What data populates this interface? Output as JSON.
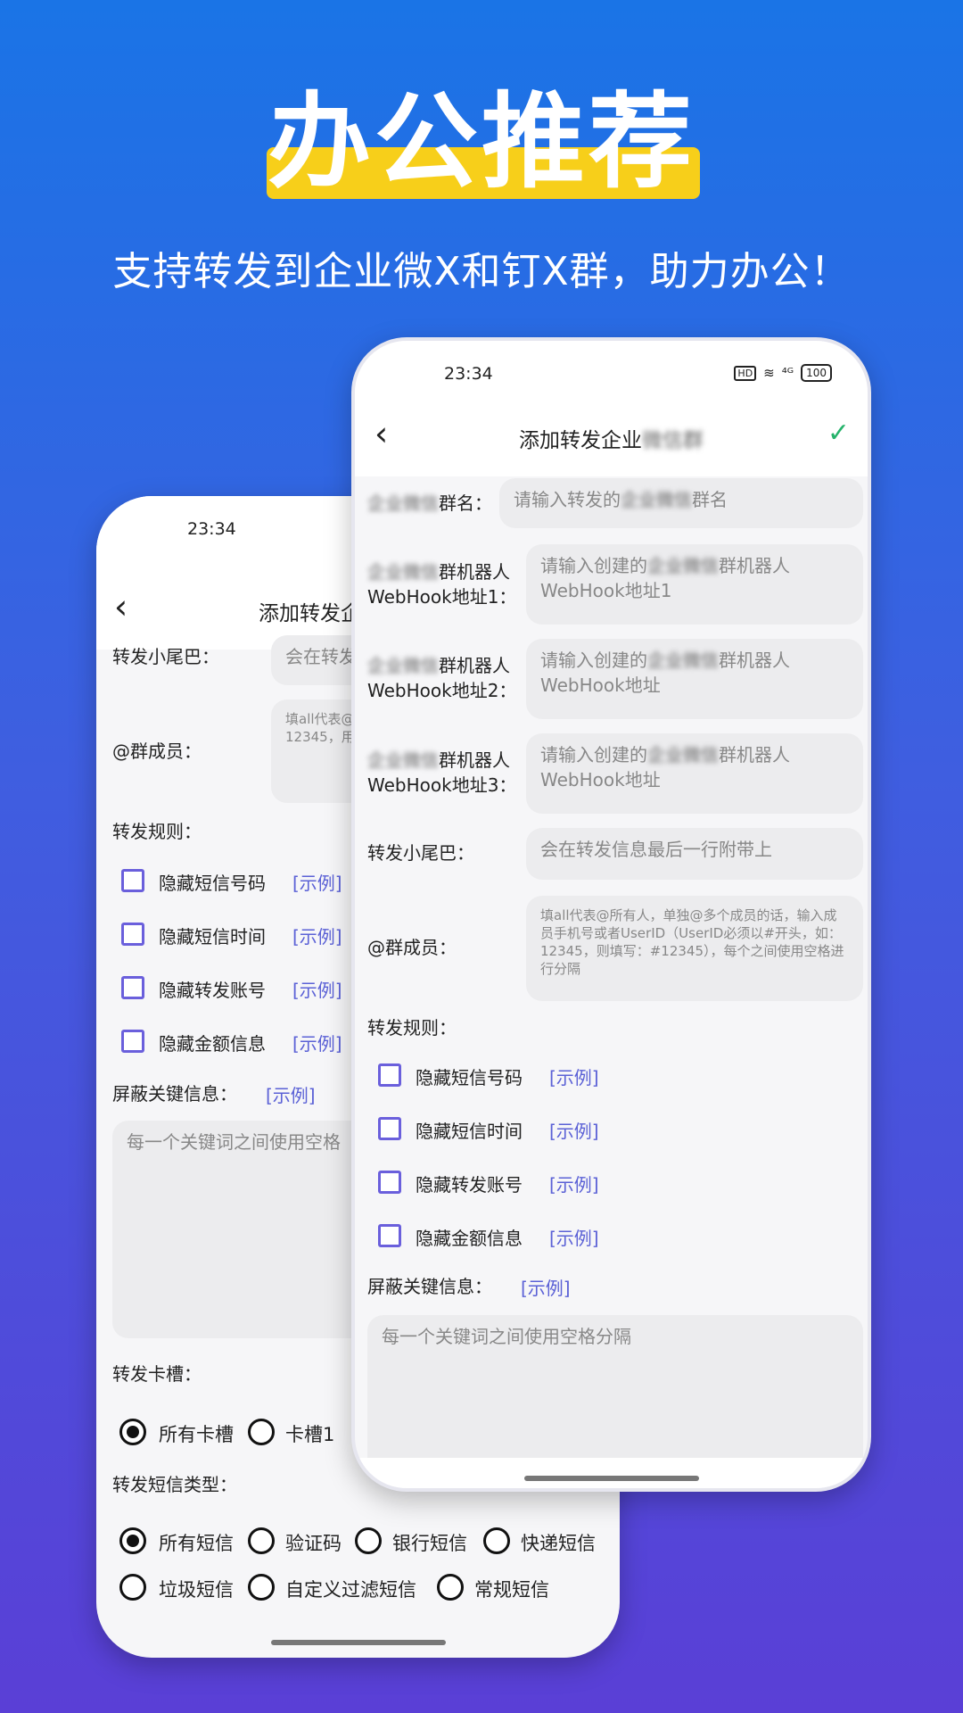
{
  "hero": {
    "title": "办公推荐",
    "subtitle": "支持转发到企业微X和钉X群，助力办公！"
  },
  "back_phone": {
    "time": "23:34",
    "title": "添加转发企",
    "fields": {
      "tail_label": "转发小尾巴：",
      "tail_placeholder": "会在转发",
      "members_label": "@群成员：",
      "members_placeholder": "填all代表@所有人，成员手机号或者UserID，如：12345，用空格进行分隔"
    },
    "rules_label": "转发规则：",
    "rules": [
      {
        "label": "隐藏短信号码",
        "example": "[示例]"
      },
      {
        "label": "隐藏短信时间",
        "example": "[示例]"
      },
      {
        "label": "隐藏转发账号",
        "example": "[示例]"
      },
      {
        "label": "隐藏金额信息",
        "example": "[示例]"
      }
    ],
    "keywords_label": "屏蔽关键信息：",
    "keywords_example": "[示例]",
    "keywords_placeholder": "每一个关键词之间使用空格",
    "sim_label": "转发卡槽：",
    "sim_options": [
      "所有卡槽",
      "卡槽1"
    ],
    "sms_type_label": "转发短信类型：",
    "sms_types_row1": [
      "所有短信",
      "验证码",
      "银行短信",
      "快递短信"
    ],
    "sms_types_row2": [
      "垃圾短信",
      "自定义过滤短信",
      "常规短信"
    ]
  },
  "front_phone": {
    "time": "23:34",
    "status_icons": {
      "hd": "HD",
      "wifi": "≋",
      "signal": "⁴ᴳ",
      "battery": "100"
    },
    "title_prefix": "添加转发企业",
    "title_blur": "微信群",
    "group_name_label_blur": "企业微信",
    "group_name_label": "群名：",
    "group_name_placeholder_a": "请输入转发的",
    "group_name_placeholder_blur": "企业微信",
    "group_name_placeholder_b": "群名",
    "webhooks": [
      {
        "label_blur": "企业微信",
        "label_a": "群机器人",
        "label_b": "WebHook地址1：",
        "ph_a": "请输入创建的",
        "ph_blur": "企业微信",
        "ph_b": "群机器人",
        "ph_c": "WebHook地址1"
      },
      {
        "label_blur": "企业微信",
        "label_a": "群机器人",
        "label_b": "WebHook地址2：",
        "ph_a": "请输入创建的",
        "ph_blur": "企业微信",
        "ph_b": "群机器人",
        "ph_c": "WebHook地址"
      },
      {
        "label_blur": "企业微信",
        "label_a": "群机器人",
        "label_b": "WebHook地址3：",
        "ph_a": "请输入创建的",
        "ph_blur": "企业微信",
        "ph_b": "群机器人",
        "ph_c": "WebHook地址"
      }
    ],
    "tail_label": "转发小尾巴：",
    "tail_placeholder": "会在转发信息最后一行附带上",
    "members_label": "@群成员：",
    "members_placeholder": "填all代表@所有人，单独@多个成员的话，输入成员手机号或者UserID（UserID必须以#开头，如：12345，则填写：#12345），每个之间使用空格进行分隔",
    "rules_label": "转发规则：",
    "rules": [
      {
        "label": "隐藏短信号码",
        "example": "[示例]"
      },
      {
        "label": "隐藏短信时间",
        "example": "[示例]"
      },
      {
        "label": "隐藏转发账号",
        "example": "[示例]"
      },
      {
        "label": "隐藏金额信息",
        "example": "[示例]"
      }
    ],
    "keywords_label": "屏蔽关键信息：",
    "keywords_example": "[示例]",
    "keywords_placeholder": "每一个关键词之间使用空格分隔"
  }
}
